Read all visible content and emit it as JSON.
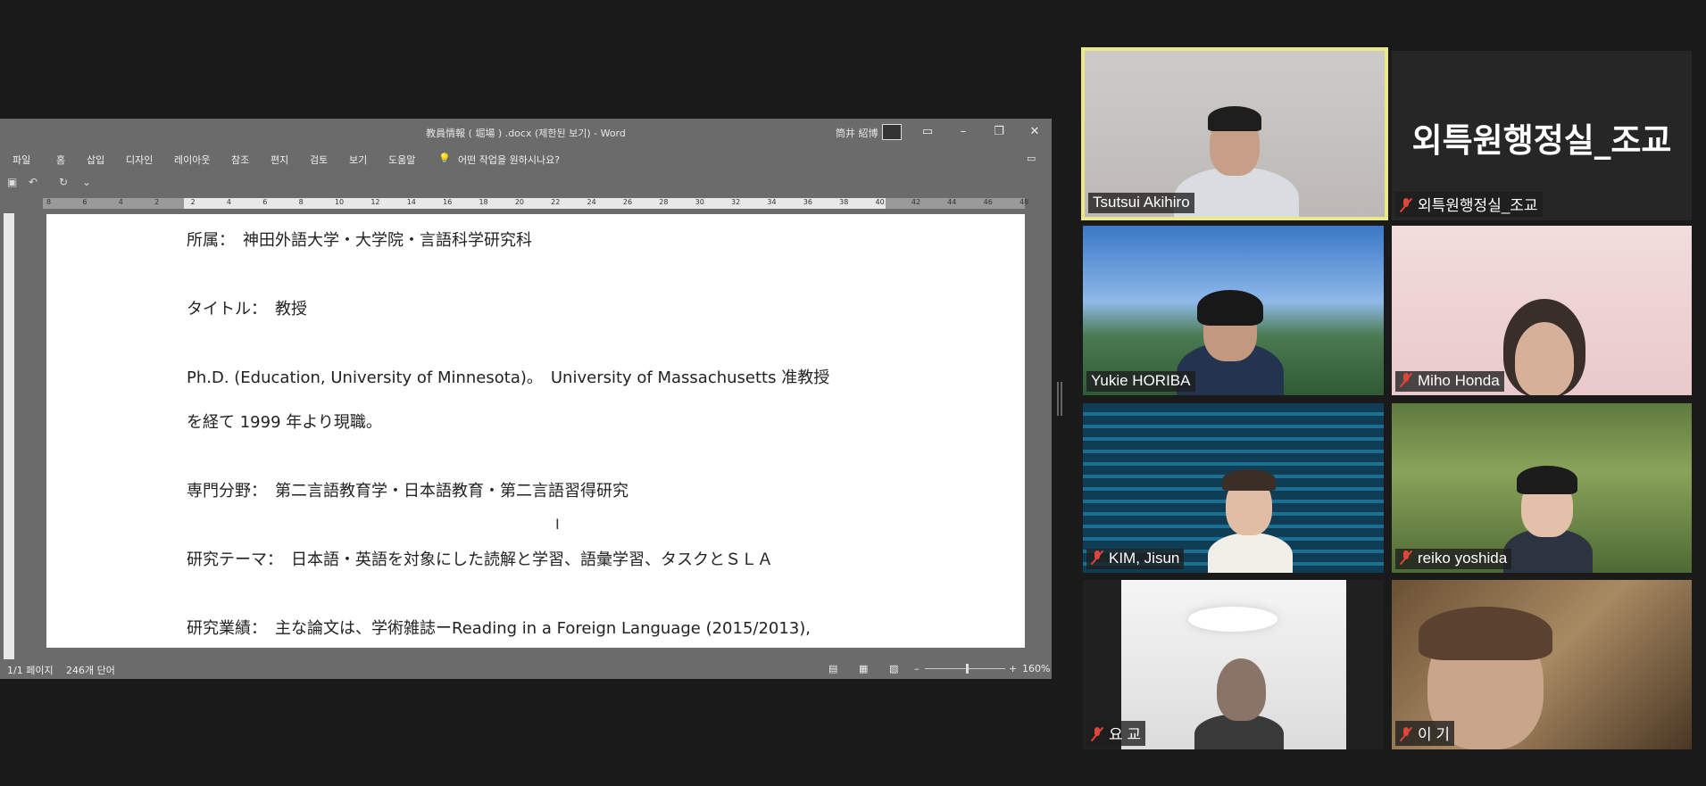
{
  "word": {
    "title": "教員情報 ( 堀場 ) .docx (제한된 보기)  -  Word",
    "user": "筒井 紹博",
    "menu": [
      "파일",
      "홈",
      "삽입",
      "디자인",
      "레이아웃",
      "참조",
      "편지",
      "검토",
      "보기",
      "도움말"
    ],
    "tell_me": "어떤 작업을 원하시나요?",
    "paragraphs": [
      "所属：　神田外語大学・大学院・言語科学研究科",
      "タイトル：　教授",
      "Ph.D. (Education, University of Minnesota)。　University of Massachusetts 准教授",
      "を経て 1999 年より現職。",
      "専門分野：　第二言語教育学・日本語教育・第二言語習得研究",
      "研究テーマ：　日本語・英語を対象にした読解と学習、語彙学習、タスクとＳＬＡ",
      "研究業績：　主な論文は、学術雑誌ーReading in a Foreign Language (2015/2013),"
    ],
    "status": {
      "page": "1/1 페이지",
      "words": "246개 단어",
      "zoom": "160%"
    },
    "ruler_numbers": [
      "8",
      "6",
      "4",
      "2",
      "2",
      "4",
      "6",
      "8",
      "10",
      "12",
      "14",
      "16",
      "18",
      "20",
      "22",
      "24",
      "26",
      "28",
      "30",
      "32",
      "34",
      "36",
      "38",
      "40",
      "42",
      "44",
      "46",
      "48"
    ]
  },
  "participants": [
    {
      "name": "Tsutsui Akihiro",
      "muted": false,
      "active": true
    },
    {
      "name": "외특원행정실_조교",
      "muted": true,
      "label": "외특원행정실_조교"
    },
    {
      "name": "Yukie HORIBA",
      "muted": false
    },
    {
      "name": "Miho Honda",
      "muted": true
    },
    {
      "name": "KIM, Jisun",
      "muted": true
    },
    {
      "name": "reiko yoshida",
      "muted": true
    },
    {
      "name": "요  교",
      "muted": true
    },
    {
      "name": "이  기",
      "muted": true
    }
  ]
}
